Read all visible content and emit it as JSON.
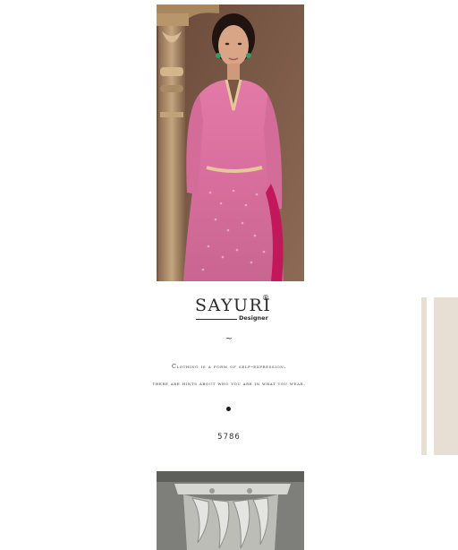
{
  "brand": {
    "name": "SAYURI",
    "registered_mark": "®",
    "subtitle": "Designer"
  },
  "separator": "~",
  "quote": {
    "line1": "Clothing is a form of self-expression.",
    "line2": "there are hints about who you are in what you wear."
  },
  "design_code": "5786",
  "colors": {
    "background": "#ffffff",
    "beige_accent": "#e8dfd4",
    "outfit_pink": "#d9709c",
    "text": "#2a2a2a"
  }
}
